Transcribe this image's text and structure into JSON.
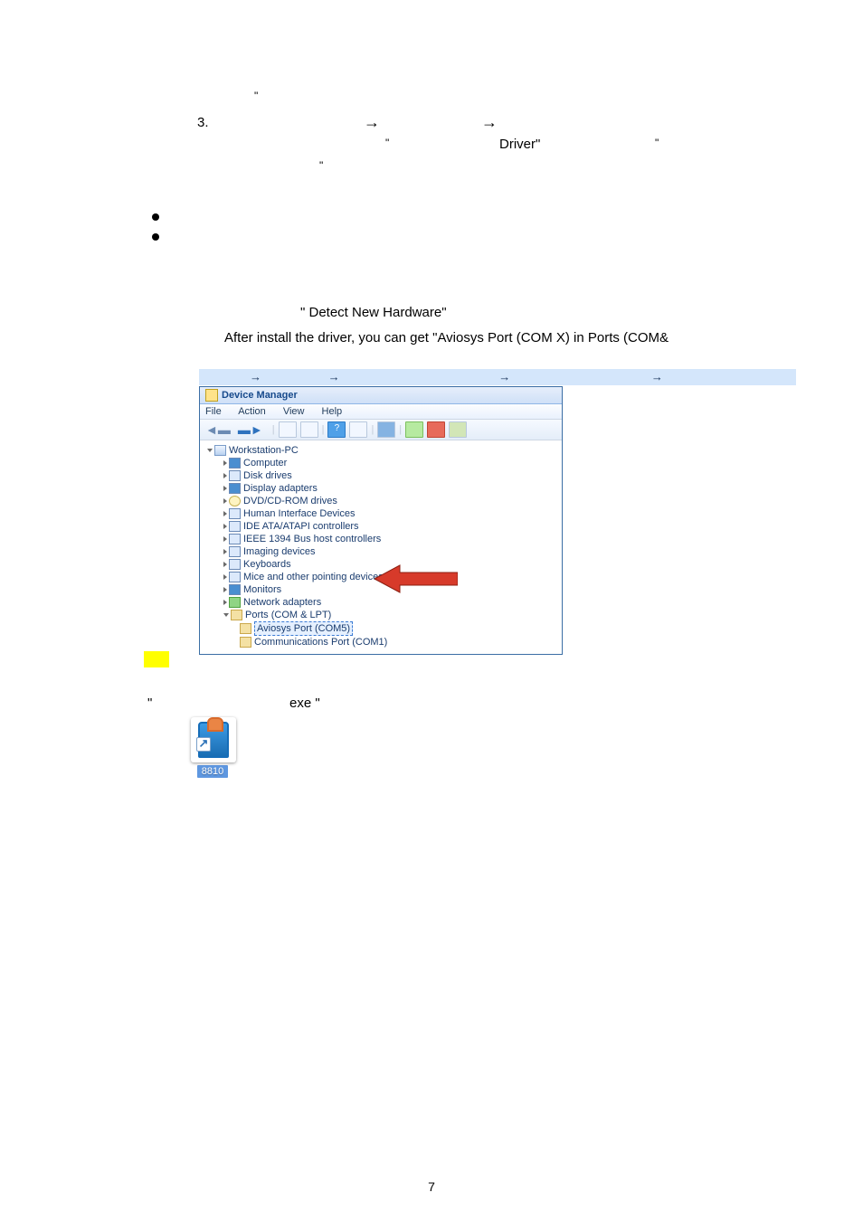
{
  "para1_quote": "\"",
  "para2_num": "3.",
  "para2_arrow": "→",
  "para2_arrow2": "→",
  "para3_quote": "\"",
  "para3_word": "Driver\"",
  "para3_quote2": "\"",
  "para4_quote": "\"",
  "detect_line": "\" Detect New Hardware\"",
  "after_line": "After install the driver, you can get \"Aviosys Port (COM X)   in Ports (COM&",
  "breadcrumb_arrows": "→",
  "dm": {
    "title": "Device Manager",
    "menu": {
      "file": "File",
      "action": "Action",
      "view": "View",
      "help": "Help"
    },
    "tree": {
      "root": "Workstation-PC",
      "items": [
        "Computer",
        "Disk drives",
        "Display adapters",
        "DVD/CD-ROM drives",
        "Human Interface Devices",
        "IDE ATA/ATAPI controllers",
        "IEEE 1394 Bus host controllers",
        "Imaging devices",
        "Keyboards",
        "Mice and other pointing devices",
        "Monitors",
        "Network adapters",
        "Ports (COM & LPT)"
      ],
      "ports_children": [
        "Aviosys Port (COM5)",
        "Communications Port (COM1)"
      ]
    }
  },
  "exe_label": "exe \"",
  "open_quote": "\"",
  "icon_caption": "8810",
  "page_num": "7"
}
